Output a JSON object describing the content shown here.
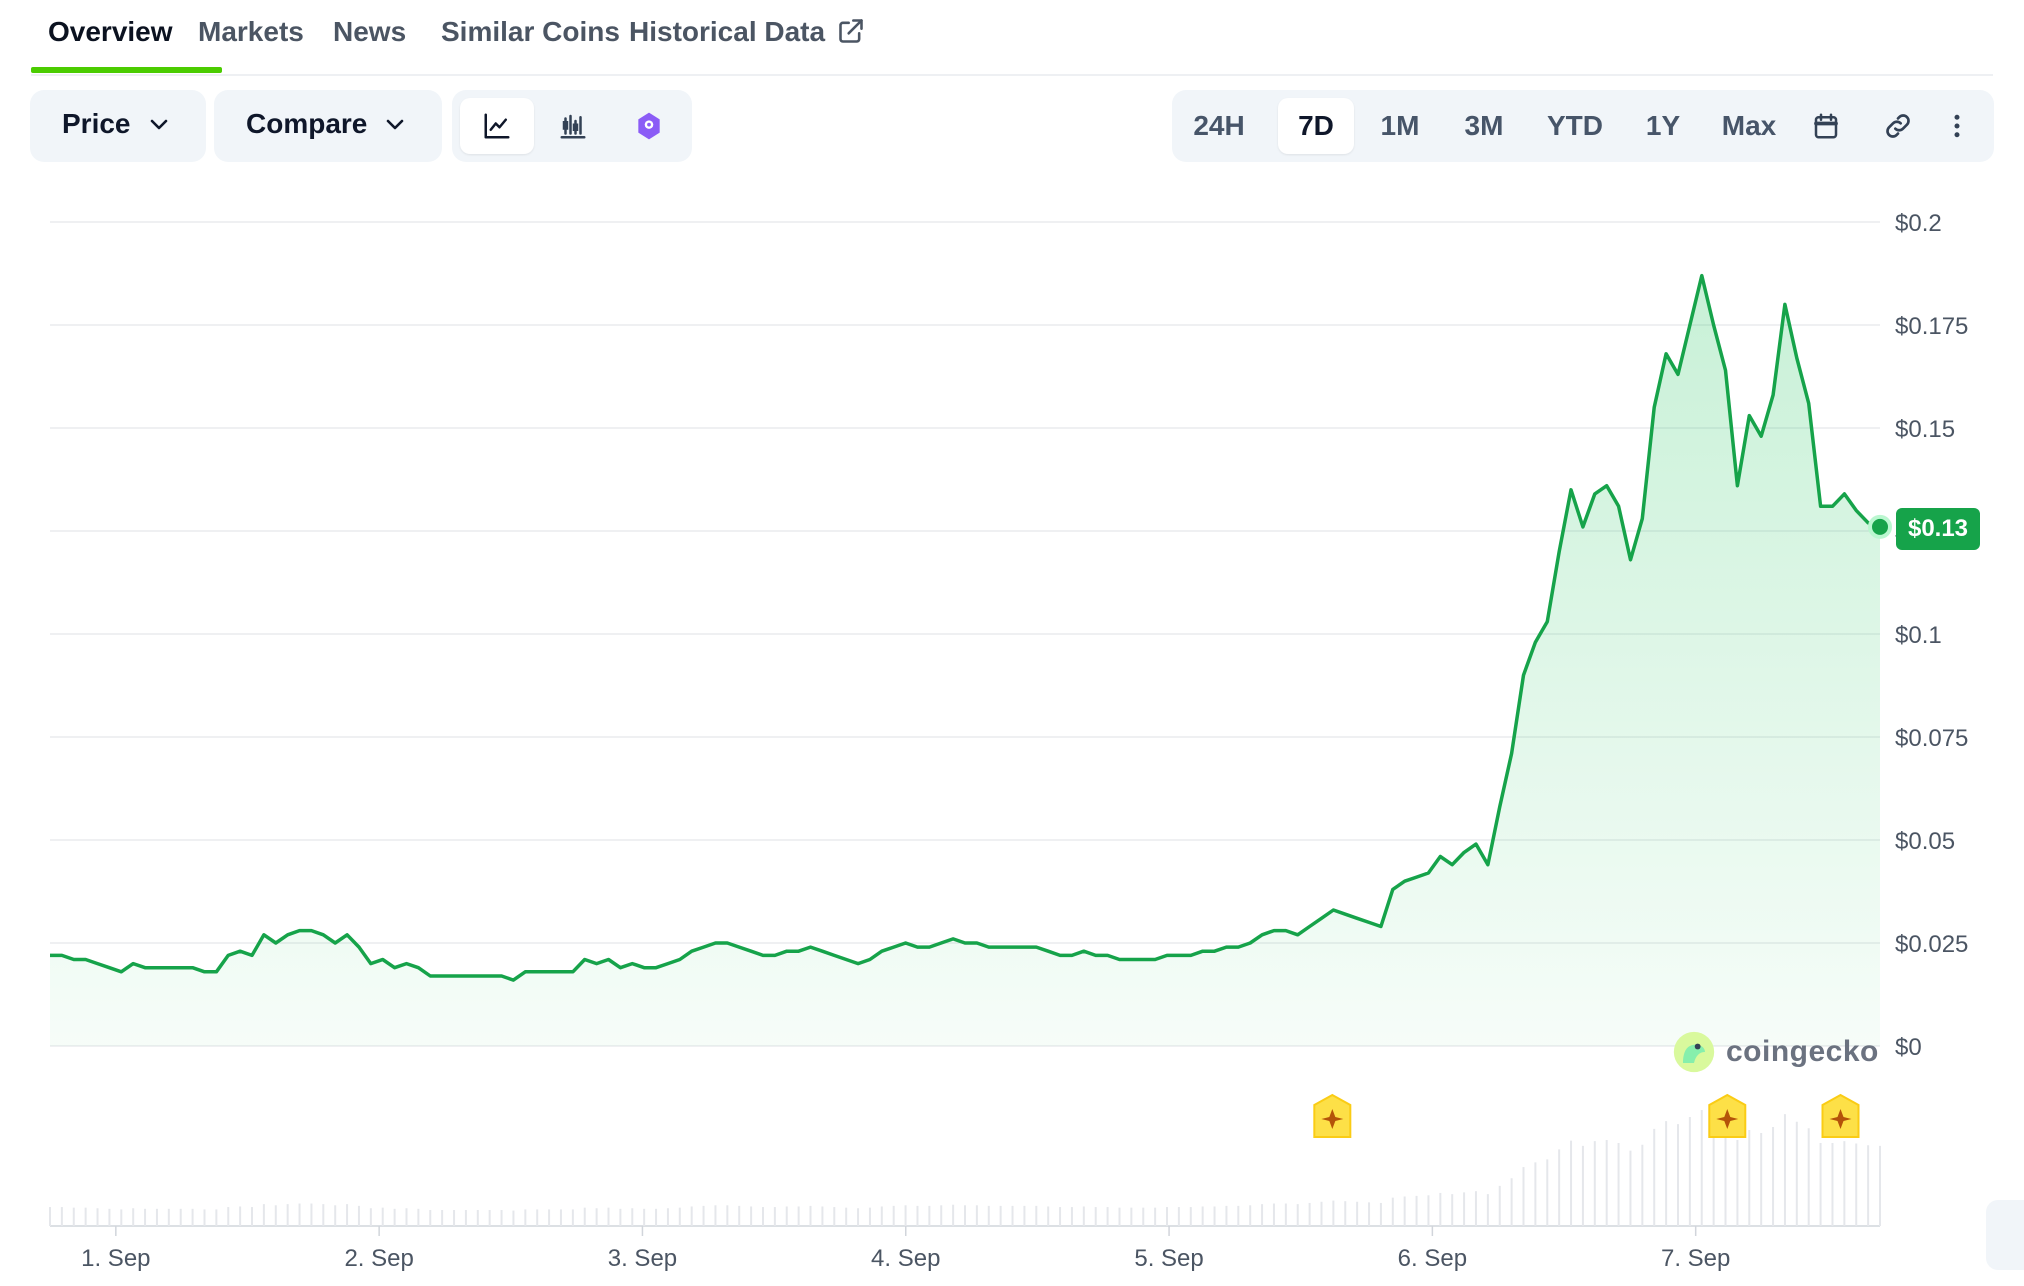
{
  "tabs": [
    {
      "label": "Overview",
      "active": true
    },
    {
      "label": "Markets"
    },
    {
      "label": "News"
    },
    {
      "label": "Similar Coins"
    },
    {
      "label": "Historical Data",
      "external": true
    }
  ],
  "controls": {
    "price_label": "Price",
    "compare_label": "Compare",
    "chart_types": [
      "line-chart-icon",
      "candlestick-icon",
      "tradingview-icon"
    ],
    "active_chart_type": "line-chart-icon"
  },
  "ranges": [
    "24H",
    "7D",
    "1M",
    "3M",
    "YTD",
    "1Y",
    "Max"
  ],
  "active_range": "7D",
  "toolbar_icons": [
    "calendar-icon",
    "link-icon",
    "more-vertical-icon"
  ],
  "current_price_label": "$0.13",
  "watermark": "coingecko",
  "colors": {
    "accent": "#4bcc00",
    "line": "#16a34a",
    "fill": "#dcfce7"
  },
  "chart_data": {
    "type": "area",
    "ylim": [
      0,
      0.2
    ],
    "y_ticks": [
      "$0.2",
      "$0.175",
      "$0.15",
      "$0.125",
      "$0.1",
      "$0.075",
      "$0.05",
      "$0.025",
      "$0"
    ],
    "x_ticks": [
      "1. Sep",
      "2. Sep",
      "3. Sep",
      "4. Sep",
      "5. Sep",
      "6. Sep",
      "7. Sep"
    ],
    "x_tick_day": [
      0.25,
      1.25,
      2.25,
      3.25,
      4.25,
      5.25,
      6.25
    ],
    "x_range_days": [
      0,
      6.95
    ],
    "series": [
      {
        "values": [
          0.022,
          0.022,
          0.021,
          0.021,
          0.02,
          0.019,
          0.018,
          0.02,
          0.019,
          0.019,
          0.019,
          0.019,
          0.019,
          0.018,
          0.018,
          0.022,
          0.023,
          0.022,
          0.027,
          0.025,
          0.027,
          0.028,
          0.028,
          0.027,
          0.025,
          0.027,
          0.024,
          0.02,
          0.021,
          0.019,
          0.02,
          0.019,
          0.017,
          0.017,
          0.017,
          0.017,
          0.017,
          0.017,
          0.017,
          0.016,
          0.018,
          0.018,
          0.018,
          0.018,
          0.018,
          0.021,
          0.02,
          0.021,
          0.019,
          0.02,
          0.019,
          0.019,
          0.02,
          0.021,
          0.023,
          0.024,
          0.025,
          0.025,
          0.024,
          0.023,
          0.022,
          0.022,
          0.023,
          0.023,
          0.024,
          0.023,
          0.022,
          0.021,
          0.02,
          0.021,
          0.023,
          0.024,
          0.025,
          0.024,
          0.024,
          0.025,
          0.026,
          0.025,
          0.025,
          0.024,
          0.024,
          0.024,
          0.024,
          0.024,
          0.023,
          0.022,
          0.022,
          0.023,
          0.022,
          0.022,
          0.021,
          0.021,
          0.021,
          0.021,
          0.022,
          0.022,
          0.022,
          0.023,
          0.023,
          0.024,
          0.024,
          0.025,
          0.027,
          0.028,
          0.028,
          0.027,
          0.029,
          0.031,
          0.033,
          0.032,
          0.031,
          0.03,
          0.029,
          0.038,
          0.04,
          0.041,
          0.042,
          0.046,
          0.044,
          0.047,
          0.049,
          0.044,
          0.058,
          0.071,
          0.09,
          0.098,
          0.103,
          0.12,
          0.135,
          0.126,
          0.134,
          0.136,
          0.131,
          0.118,
          0.128,
          0.155,
          0.168,
          0.163,
          0.175,
          0.187,
          0.175,
          0.164,
          0.136,
          0.153,
          0.148,
          0.158,
          0.18,
          0.167,
          0.156,
          0.131,
          0.131,
          0.134,
          0.13,
          0.127,
          0.126
        ],
        "name": ""
      }
    ],
    "volume_note": "",
    "event_markers_day": [
      4.87,
      6.37,
      6.8
    ]
  }
}
